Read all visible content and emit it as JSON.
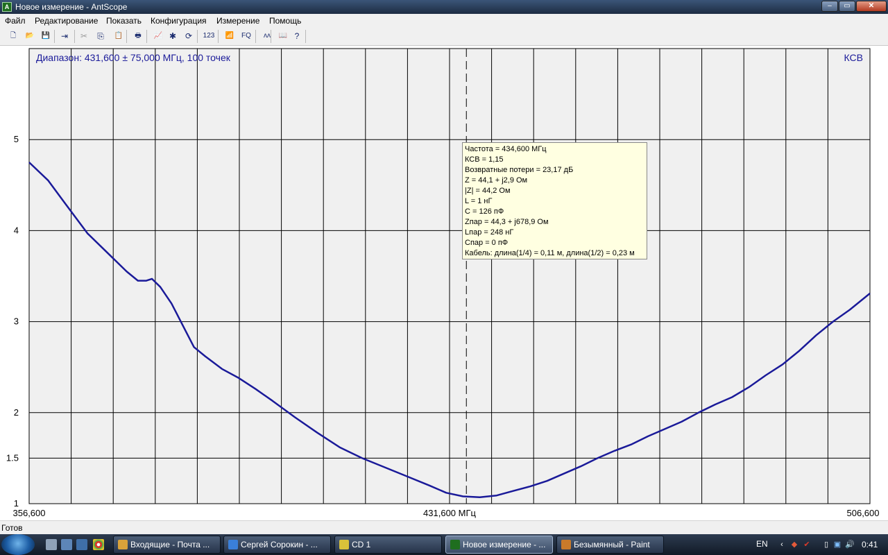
{
  "window": {
    "title": "Новое измерение - AntScope"
  },
  "menu": [
    {
      "label": "Файл"
    },
    {
      "label": "Редактирование"
    },
    {
      "label": "Показать"
    },
    {
      "label": "Конфигурация"
    },
    {
      "label": "Измерение"
    },
    {
      "label": "Помощь"
    }
  ],
  "toolbar": {
    "buttons": [
      {
        "name": "new-file-icon",
        "glyph": "🗋",
        "enabled": true
      },
      {
        "name": "open-folder-icon",
        "glyph": "📂",
        "enabled": true
      },
      {
        "name": "save-icon",
        "glyph": "💾",
        "enabled": true
      },
      {
        "name": "export-icon",
        "glyph": "⇥",
        "enabled": true
      },
      {
        "name": "cut-icon",
        "glyph": "✂",
        "enabled": false
      },
      {
        "name": "copy-icon",
        "glyph": "⎘",
        "enabled": true
      },
      {
        "name": "paste-icon",
        "glyph": "📋",
        "enabled": false
      },
      {
        "name": "print-icon",
        "glyph": "🖶",
        "enabled": true
      },
      {
        "name": "chart-icon",
        "glyph": "📈",
        "enabled": true
      },
      {
        "name": "settings-star-icon",
        "glyph": "✱",
        "enabled": true
      },
      {
        "name": "refresh-icon",
        "glyph": "⟳",
        "enabled": true
      },
      {
        "name": "numeric-icon",
        "glyph": "123",
        "enabled": true
      },
      {
        "name": "antenna-icon",
        "glyph": "📶",
        "enabled": true
      },
      {
        "name": "frequency-quick-icon",
        "glyph": "FQ",
        "enabled": true
      },
      {
        "name": "waveform-icon",
        "glyph": "ʌʌ",
        "enabled": true
      },
      {
        "name": "book-icon",
        "glyph": "📖",
        "enabled": true
      },
      {
        "name": "help-icon",
        "glyph": "?",
        "enabled": true
      }
    ]
  },
  "chart_data": {
    "type": "line",
    "title": "Диапазон: 431,600 ± 75,000 МГц, 100 точек",
    "ylabel": "КСВ",
    "xlim": [
      356.6,
      506.6
    ],
    "ylim": [
      1,
      6
    ],
    "x_ticks": [
      "356,600",
      "431,600 МГц",
      "506,600"
    ],
    "y_ticks": [
      {
        "value": 1,
        "label": "1"
      },
      {
        "value": 1.5,
        "label": "1.5"
      },
      {
        "value": 2,
        "label": "2"
      },
      {
        "value": 3,
        "label": "3"
      },
      {
        "value": 4,
        "label": "4"
      },
      {
        "value": 5,
        "label": "5"
      }
    ],
    "cursor_x": 434.6,
    "grid": true,
    "line_color": "#1a1a99",
    "plot_bg": "#f0f0f0",
    "series": [
      {
        "points": [
          [
            356.6,
            4.75
          ],
          [
            360.0,
            4.55
          ],
          [
            363.0,
            4.3
          ],
          [
            367.0,
            3.97
          ],
          [
            371.0,
            3.73
          ],
          [
            374.0,
            3.55
          ],
          [
            376.0,
            3.45
          ],
          [
            377.5,
            3.45
          ],
          [
            378.5,
            3.47
          ],
          [
            380.0,
            3.38
          ],
          [
            382.0,
            3.2
          ],
          [
            384.5,
            2.9
          ],
          [
            386.0,
            2.72
          ],
          [
            388.0,
            2.62
          ],
          [
            391.0,
            2.48
          ],
          [
            394.0,
            2.38
          ],
          [
            397.0,
            2.26
          ],
          [
            400.0,
            2.13
          ],
          [
            404.0,
            1.95
          ],
          [
            408.0,
            1.78
          ],
          [
            412.0,
            1.62
          ],
          [
            416.0,
            1.5
          ],
          [
            420.0,
            1.4
          ],
          [
            424.0,
            1.3
          ],
          [
            428.0,
            1.2
          ],
          [
            431.0,
            1.12
          ],
          [
            434.0,
            1.08
          ],
          [
            437.0,
            1.07
          ],
          [
            440.0,
            1.09
          ],
          [
            443.0,
            1.14
          ],
          [
            446.0,
            1.19
          ],
          [
            449.0,
            1.25
          ],
          [
            452.0,
            1.33
          ],
          [
            455.0,
            1.41
          ],
          [
            458.0,
            1.5
          ],
          [
            461.0,
            1.58
          ],
          [
            464.0,
            1.65
          ],
          [
            467.0,
            1.74
          ],
          [
            470.0,
            1.82
          ],
          [
            473.0,
            1.9
          ],
          [
            476.0,
            2.0
          ],
          [
            479.0,
            2.09
          ],
          [
            482.0,
            2.17
          ],
          [
            485.0,
            2.28
          ],
          [
            488.0,
            2.41
          ],
          [
            491.0,
            2.53
          ],
          [
            494.0,
            2.68
          ],
          [
            497.0,
            2.85
          ],
          [
            500.0,
            3.0
          ],
          [
            503.0,
            3.13
          ],
          [
            506.6,
            3.31
          ]
        ]
      }
    ]
  },
  "readout": {
    "lines": [
      "Частота = 434,600 МГц",
      "КСВ = 1,15",
      "Возвратные потери = 23,17 дБ",
      "Z = 44,1 + j2,9 Ом",
      "|Z| = 44,2 Ом",
      "L = 1 нГ",
      "C = 126 пФ",
      "Zпар = 44,3 + j678,9 Ом",
      "Lпар = 248 нГ",
      "Cпар = 0 пФ",
      "Кабель: длина(1/4) = 0,11 м, длина(1/2) = 0,23 м"
    ]
  },
  "status": {
    "text": "Готов"
  },
  "taskbar": {
    "tasks": [
      {
        "label": "Входящие - Почта ...",
        "icon_color": "#d9a23a",
        "active": false
      },
      {
        "label": "Сергей Сорокин - ...",
        "icon_color": "#3a7fd9",
        "active": false
      },
      {
        "label": "CD 1",
        "icon_color": "#d9c23a",
        "active": false
      },
      {
        "label": "Новое измерение - ...",
        "icon_color": "#1f6e1f",
        "active": true
      },
      {
        "label": "Безымянный - Paint",
        "icon_color": "#c97a2a",
        "active": false
      }
    ],
    "tray": {
      "lang": "EN",
      "clock": "0:41"
    }
  }
}
